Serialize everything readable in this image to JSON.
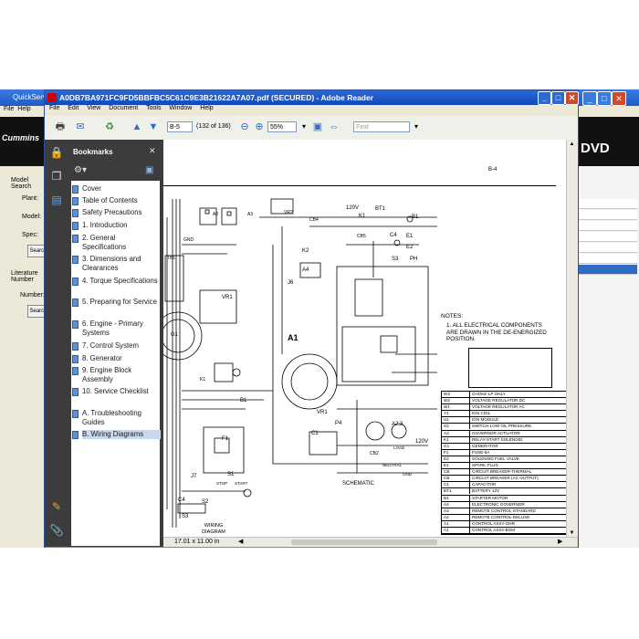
{
  "background_app": {
    "title": "QuickServe",
    "menu": [
      "File",
      "Help"
    ],
    "banner_logo": "Cummins",
    "banner_right_text": "DVD",
    "left_panel": {
      "section1": "Model Search",
      "plant_label": "Plant:",
      "model_label": "Model:",
      "spec_label": "Spec:",
      "search_button": "Search",
      "section2": "Literature Number",
      "number_label": "Number:",
      "search_button2": "Search"
    }
  },
  "window": {
    "title": "A0DB7BA971FC9FD5BBFBC5C61C9E3B21622A7A07.pdf (SECURED) - Adobe Reader",
    "menu": [
      "File",
      "Edit",
      "View",
      "Document",
      "Tools",
      "Window",
      "Help"
    ],
    "controls": {
      "minimize": "_",
      "maximize": "□",
      "close": "✕"
    }
  },
  "toolbar": {
    "page_field": "B-5",
    "page_count": "(132 of 136)",
    "zoom_value": "55%",
    "find_placeholder": "Find"
  },
  "bookmarks": {
    "header": "Bookmarks",
    "items": [
      {
        "label": "Cover"
      },
      {
        "label": "Table of Contents"
      },
      {
        "label": "Safety Precautions"
      },
      {
        "label": "1. Introduction"
      },
      {
        "label": "2. General Specifications"
      },
      {
        "label": "3. Dimensions and Clearances"
      },
      {
        "label": "4. Torque Specifications"
      },
      {
        "label": "5. Preparing for Service"
      },
      {
        "label": "6. Engine - Primary Systems"
      },
      {
        "label": "7. Control System"
      },
      {
        "label": "8. Generator"
      },
      {
        "label": "9. Engine Block Assembly"
      },
      {
        "label": "10. Service Checklist"
      },
      {
        "label": "A. Troubleshooting Guides"
      },
      {
        "label": "B. Wiring Diagrams"
      }
    ],
    "selected_index": 14
  },
  "document": {
    "page_label": "B-4",
    "notes_title": "NOTES:",
    "note1": "1. ALL ELECTRICAL COMPONENTS ARE DRAWN IN THE DE-ENERGIZED POSITION.",
    "schematic_label": "SCHEMATIC",
    "wiring_label": "WIRING DIAGRAM",
    "labels": [
      "120V",
      "GND",
      "A2",
      "A3",
      "VR2",
      "CB4",
      "K1",
      "BT1",
      "B1",
      "CB5",
      "C4",
      "E1",
      "E2",
      "K2",
      "A4",
      "S3",
      "PH",
      "J6",
      "TB1",
      "VR1",
      "G1",
      "A1",
      "K1",
      "B1",
      "S1",
      "F1",
      "J7",
      "C4",
      "S2",
      "S3",
      "START",
      "STOP",
      "P4",
      "C1",
      "VR1",
      "A2,3",
      "CB2",
      "LOAD",
      "NEUTRAL",
      "120V",
      "GND"
    ],
    "legend_rows": [
      [
        "W3",
        "CHOKE-LP ONLY"
      ],
      [
        "W2",
        "VOLTAGE REGULATOR DC"
      ],
      [
        "W1",
        "VOLTAGE REGULATOR AC"
      ],
      [
        "Y1",
        "IGN COIL"
      ],
      [
        "U1",
        "IGN MODULE"
      ],
      [
        "S3",
        "SWITCH-LOW OIL PRESSURE"
      ],
      [
        "A3",
        "GOVERNOR ACTUATOR"
      ],
      [
        "K1",
        "RELAY-START SOLENOID"
      ],
      [
        "G1",
        "GENERATOR"
      ],
      [
        "F1",
        "FUSE-5A"
      ],
      [
        "E2",
        "SOLENOID FUEL VALVE"
      ],
      [
        "E1",
        "SPARK PLUG"
      ],
      [
        "CB",
        "CIRCUIT BREAKER-THERMAL"
      ],
      [
        "CB",
        "CIRCUIT BREAKER (AC OUTPUT)"
      ],
      [
        "C1",
        "CAPACITOR"
      ],
      [
        "BT1",
        "BATTERY 12V"
      ],
      [
        "B1",
        "STARTER MOTOR"
      ],
      [
        "A4",
        "ELECTRONIC GOVERNOR"
      ],
      [
        "A3",
        "REMOTE CONTROL-STANDARD"
      ],
      [
        "A2",
        "REMOTE CONTROL-DELUXE"
      ],
      [
        "A1",
        "CONTROL ASSY-GNR"
      ],
      [
        "A1",
        "CONTROL ASSY-BGM"
      ]
    ]
  },
  "status": {
    "page_size": "17.01 x 11.00 in"
  }
}
